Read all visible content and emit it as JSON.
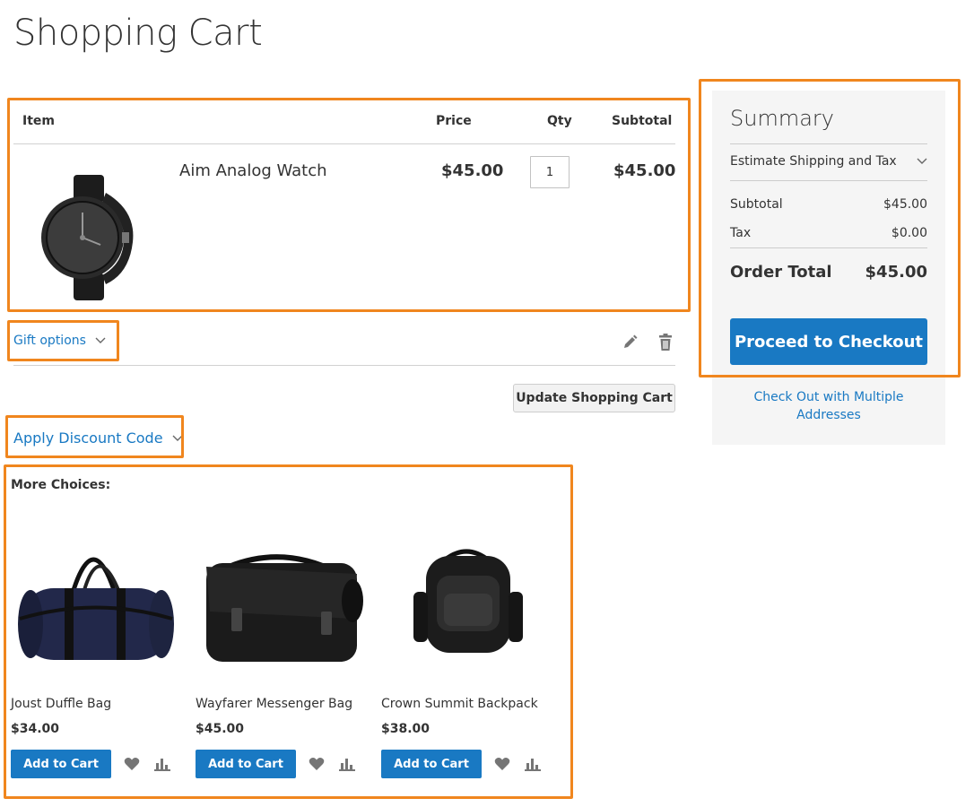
{
  "page": {
    "title": "Shopping Cart"
  },
  "cart": {
    "headers": {
      "item": "Item",
      "price": "Price",
      "qty": "Qty",
      "subtotal": "Subtotal"
    },
    "items": [
      {
        "name": "Aim Analog Watch",
        "price": "$45.00",
        "qty": "1",
        "subtotal": "$45.00"
      }
    ],
    "gift_options_label": "Gift options",
    "update_button_label": "Update Shopping Cart",
    "discount_label": "Apply Discount Code"
  },
  "more_choices": {
    "title": "More Choices:",
    "products": [
      {
        "name": "Joust Duffle Bag",
        "price": "$34.00",
        "add_label": "Add to Cart"
      },
      {
        "name": "Wayfarer Messenger Bag",
        "price": "$45.00",
        "add_label": "Add to Cart"
      },
      {
        "name": "Crown Summit Backpack",
        "price": "$38.00",
        "add_label": "Add to Cart"
      }
    ]
  },
  "summary": {
    "title": "Summary",
    "estimate_label": "Estimate Shipping and Tax",
    "subtotal_label": "Subtotal",
    "subtotal_value": "$45.00",
    "tax_label": "Tax",
    "tax_value": "$0.00",
    "order_total_label": "Order Total",
    "order_total_value": "$45.00",
    "checkout_label": "Proceed to Checkout",
    "multi_address_label": "Check Out with Multiple Addresses"
  },
  "colors": {
    "accent": "#1979c3",
    "highlight": "#f0861e",
    "summary_bg": "#f5f5f5"
  },
  "icons": [
    "chevron-down-icon",
    "pencil-icon",
    "trash-icon",
    "heart-icon",
    "compare-icon"
  ]
}
